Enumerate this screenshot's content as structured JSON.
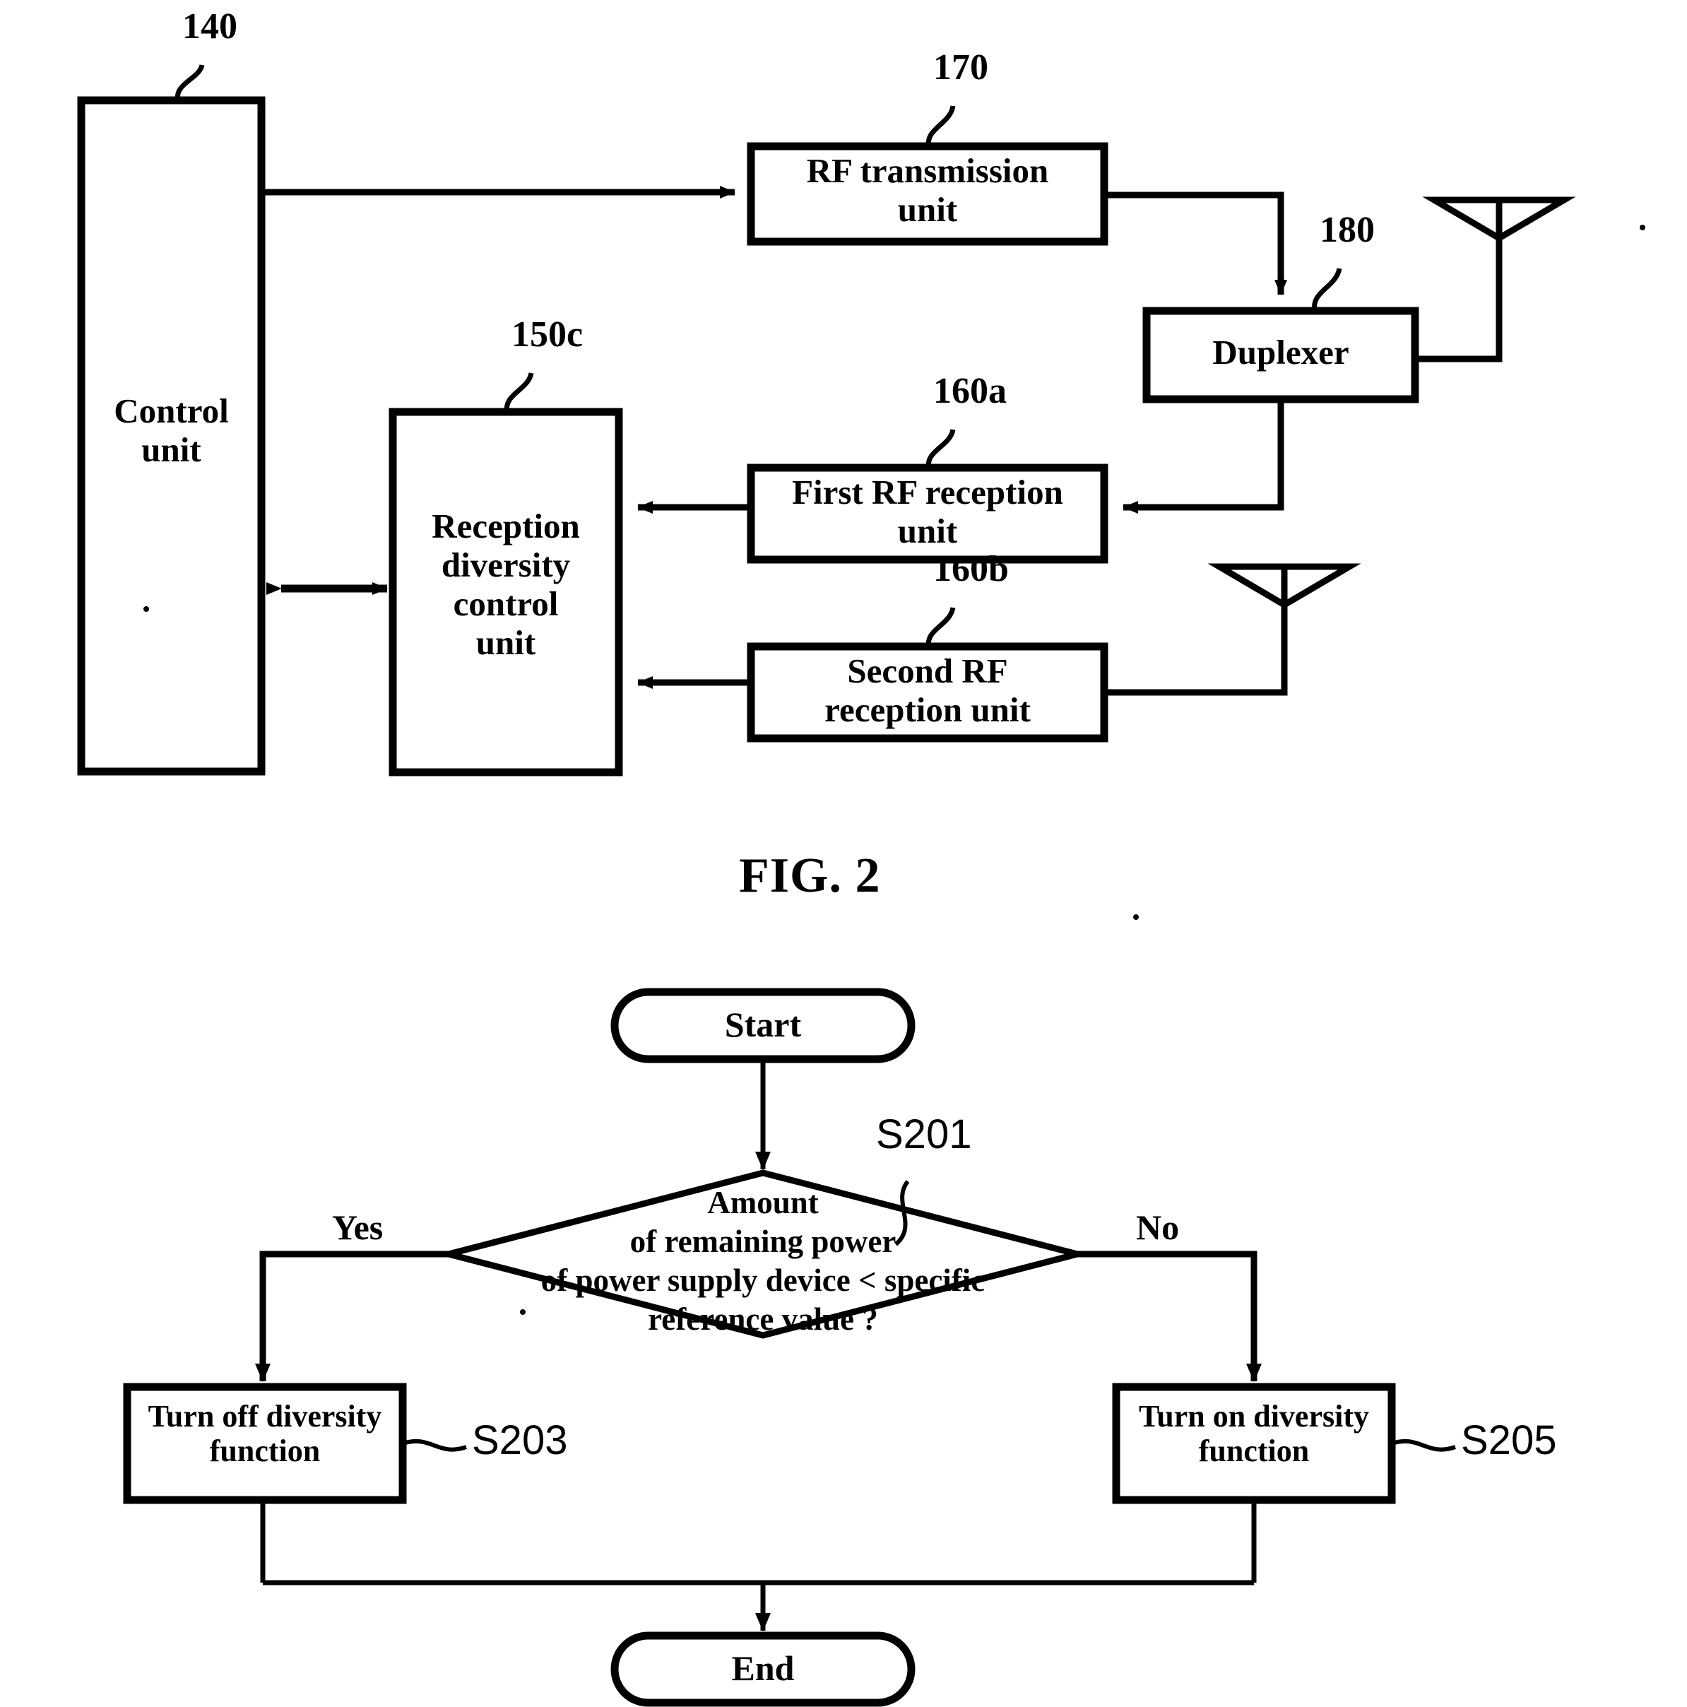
{
  "figure1": {
    "blocks": [
      {
        "id": "control-unit",
        "label": "Control\nunit",
        "ref": "140"
      },
      {
        "id": "rf-transmission-unit",
        "label": "RF transmission\nunit",
        "ref": "170"
      },
      {
        "id": "duplexer",
        "label": "Duplexer",
        "ref": "180"
      },
      {
        "id": "reception-diversity-control-unit",
        "label": "Reception\ndiversity\ncontrol\nunit",
        "ref": "150c"
      },
      {
        "id": "first-rf-reception-unit",
        "label": "First RF reception\nunit",
        "ref": "160a"
      },
      {
        "id": "second-rf-reception-unit",
        "label": "Second RF\nreception unit",
        "ref": "160b"
      }
    ],
    "antennas": [
      {
        "id": "antenna-main"
      },
      {
        "id": "antenna-diversity"
      }
    ]
  },
  "figure2": {
    "title": "FIG. 2",
    "nodes": {
      "start": "Start",
      "decision": "Amount\nof remaining power\nof power supply device < specific\nreference value ?",
      "decision_ref": "S201",
      "turn_off": "Turn off diversity\nfunction",
      "turn_off_ref": "S203",
      "turn_on": "Turn on diversity\nfunction",
      "turn_on_ref": "S205",
      "end": "End"
    },
    "branches": {
      "yes": "Yes",
      "no": "No"
    }
  },
  "colors": {
    "ink": "#000000",
    "paper": "#ffffff"
  }
}
